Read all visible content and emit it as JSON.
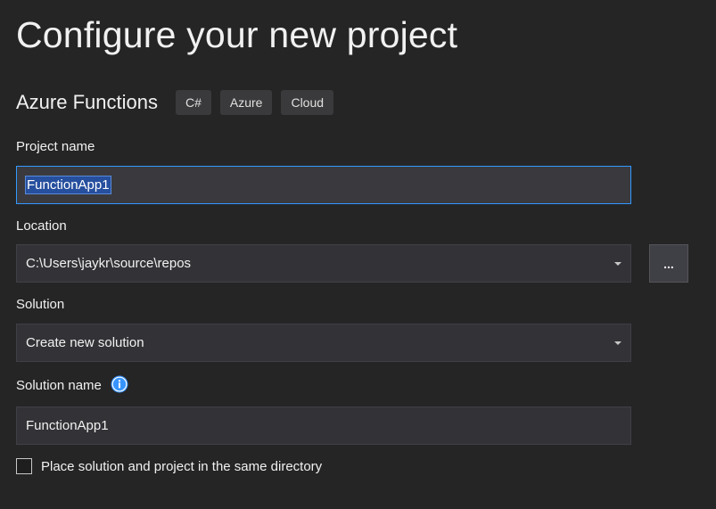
{
  "header": {
    "title": "Configure your new project"
  },
  "template": {
    "name": "Azure Functions",
    "tags": [
      "C#",
      "Azure",
      "Cloud"
    ]
  },
  "form": {
    "project_name": {
      "label": "Project name",
      "value": "FunctionApp1"
    },
    "location": {
      "label": "Location",
      "value": "C:\\Users\\jaykr\\source\\repos",
      "browse_label": "..."
    },
    "solution": {
      "label": "Solution",
      "value": "Create new solution"
    },
    "solution_name": {
      "label": "Solution name",
      "value": "FunctionApp1",
      "info_icon": "info-icon"
    },
    "same_directory": {
      "label": "Place solution and project in the same directory",
      "checked": false
    }
  },
  "colors": {
    "background": "#252526",
    "input_background": "#333337",
    "focus_border": "#3399ff",
    "selection": "#264f9e",
    "info_blue": "#3794ff"
  }
}
